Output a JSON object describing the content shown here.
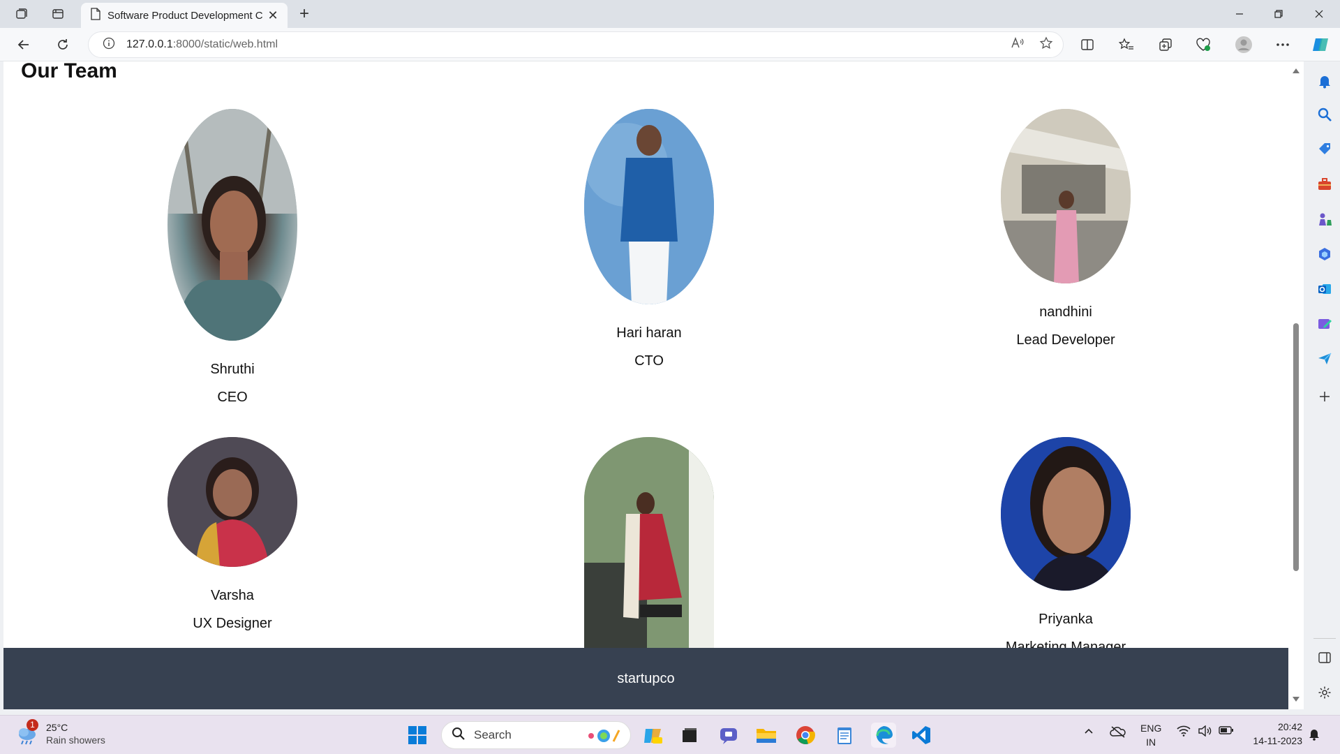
{
  "browser": {
    "tab_title": "Software Product Development C",
    "address_host": "127.0.0.1",
    "address_path": ":8000/static/web.html",
    "close_tab_glyph": "✕",
    "new_tab_glyph": "+"
  },
  "page": {
    "heading": "Our Team",
    "members": [
      {
        "name": "Shruthi",
        "role": "CEO"
      },
      {
        "name": "Hari haran",
        "role": "CTO"
      },
      {
        "name": "nandhini",
        "role": "Lead Developer"
      },
      {
        "name": "Varsha",
        "role": "UX Designer"
      },
      {
        "name": "",
        "role": ""
      },
      {
        "name": "Priyanka",
        "role": "Marketing Manager"
      }
    ],
    "footer": "startupco"
  },
  "taskbar": {
    "weather_temp": "25°C",
    "weather_desc": "Rain showers",
    "weather_badge": "1",
    "search_label": "Search",
    "lang_top": "ENG",
    "lang_bottom": "IN",
    "time": "20:42",
    "date": "14-11-2023"
  },
  "colors": {
    "footer_bg": "#374151",
    "accent": "#0067c0"
  }
}
